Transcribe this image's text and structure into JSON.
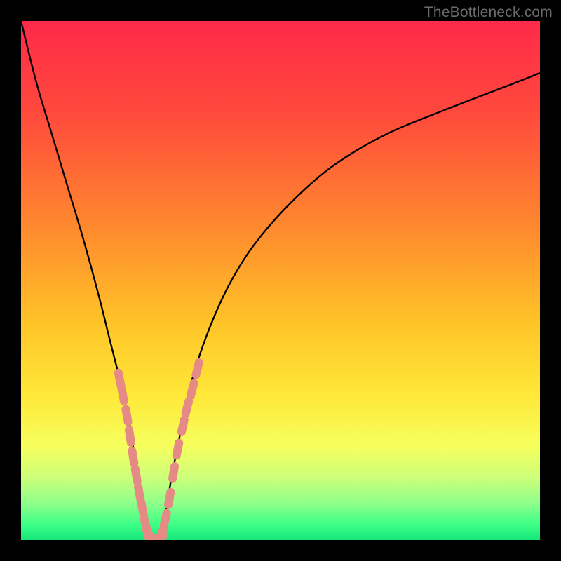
{
  "watermark": "TheBottleneck.com",
  "colors": {
    "frame": "#000000",
    "gradient_stops": [
      {
        "offset": 0.0,
        "color": "#ff2a4a"
      },
      {
        "offset": 0.18,
        "color": "#ff4a3c"
      },
      {
        "offset": 0.4,
        "color": "#ff8a2e"
      },
      {
        "offset": 0.58,
        "color": "#ffc328"
      },
      {
        "offset": 0.72,
        "color": "#ffe838"
      },
      {
        "offset": 0.82,
        "color": "#f6ff5e"
      },
      {
        "offset": 0.88,
        "color": "#ccff7a"
      },
      {
        "offset": 0.93,
        "color": "#8dff8a"
      },
      {
        "offset": 0.97,
        "color": "#3dff86"
      },
      {
        "offset": 1.0,
        "color": "#15e67a"
      }
    ],
    "curve": "#000000",
    "marker_fill": "#e68a85",
    "marker_stroke": "#c46a64"
  },
  "chart_data": {
    "type": "line",
    "title": "",
    "xlabel": "",
    "ylabel": "",
    "xlim": [
      0,
      100
    ],
    "ylim": [
      0,
      100
    ],
    "series": [
      {
        "name": "bottleneck-curve",
        "x": [
          0,
          3,
          6,
          9,
          12,
          15,
          17,
          19,
          21,
          22,
          23,
          24,
          25,
          26,
          27,
          28,
          29,
          31,
          33,
          36,
          40,
          45,
          52,
          60,
          70,
          82,
          95,
          100
        ],
        "y": [
          100,
          88,
          78,
          68,
          58,
          47,
          39,
          31,
          22,
          15,
          10,
          5,
          1,
          0,
          1,
          6,
          12,
          22,
          31,
          40,
          49,
          57,
          65,
          72,
          78,
          83,
          88,
          90
        ]
      }
    ],
    "markers": {
      "name": "highlight-points",
      "points": [
        {
          "x": 19.0,
          "y": 31.0
        },
        {
          "x": 19.6,
          "y": 28.0
        },
        {
          "x": 20.4,
          "y": 24.0
        },
        {
          "x": 21.0,
          "y": 20.0
        },
        {
          "x": 21.6,
          "y": 16.0
        },
        {
          "x": 22.2,
          "y": 12.5
        },
        {
          "x": 22.8,
          "y": 9.0
        },
        {
          "x": 23.4,
          "y": 6.0
        },
        {
          "x": 24.0,
          "y": 3.0
        },
        {
          "x": 24.7,
          "y": 1.0
        },
        {
          "x": 25.5,
          "y": 0.3
        },
        {
          "x": 26.3,
          "y": 0.3
        },
        {
          "x": 27.0,
          "y": 1.0
        },
        {
          "x": 27.8,
          "y": 4.0
        },
        {
          "x": 28.6,
          "y": 8.0
        },
        {
          "x": 29.4,
          "y": 13.0
        },
        {
          "x": 30.2,
          "y": 17.5
        },
        {
          "x": 31.2,
          "y": 22.0
        },
        {
          "x": 32.0,
          "y": 25.5
        },
        {
          "x": 33.0,
          "y": 29.0
        },
        {
          "x": 34.0,
          "y": 33.0
        }
      ]
    }
  }
}
